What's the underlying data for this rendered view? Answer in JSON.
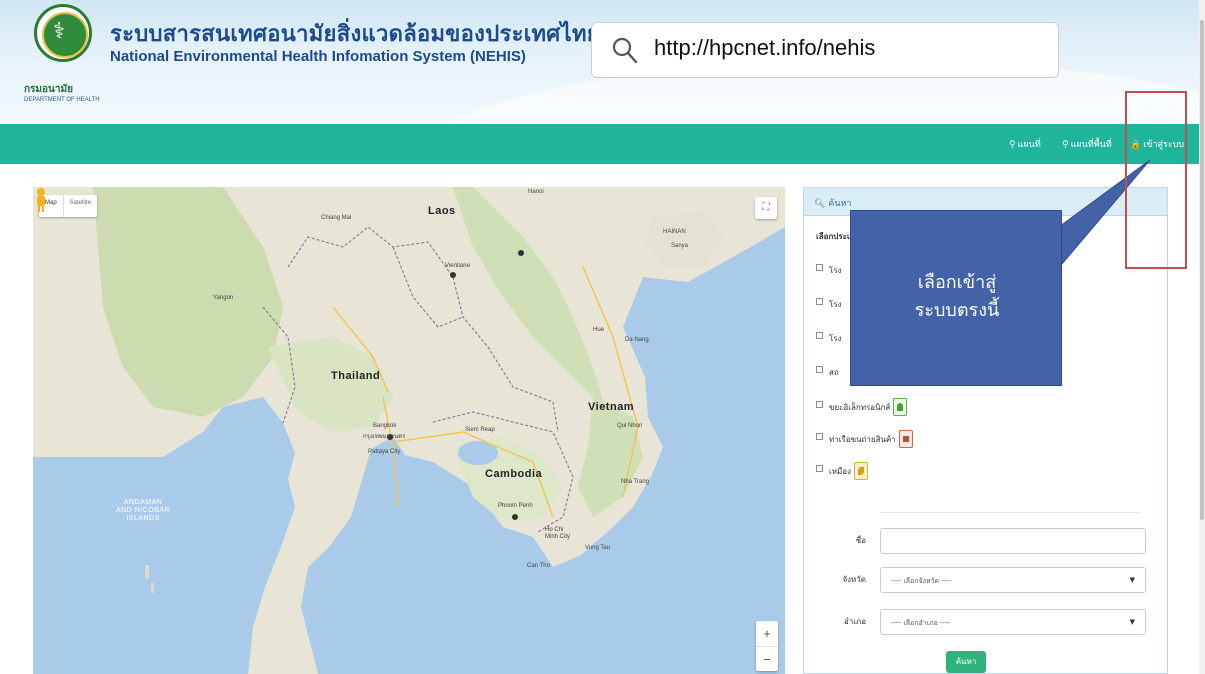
{
  "header": {
    "title_th": "ระบบสารสนเทศอนามัยสิ่งแวดล้อมของประเทศไทย",
    "title_en": "National Environmental Health Infomation System (NEHIS)",
    "logo_caption_th": "กรมอนามัย",
    "logo_caption_en": "DEPARTMENT OF HEALTH",
    "logo_icon": "department-of-health-seal"
  },
  "url_bar": {
    "search_icon": "search-icon",
    "url": "http://hpcnet.info/nehis"
  },
  "navbar": {
    "color": "#1fb59a",
    "items": [
      {
        "icon": "map-pin-icon",
        "label": "แผนที่"
      },
      {
        "icon": "map-pin-icon",
        "label": "แผนที่พื้นที่"
      },
      {
        "icon": "lock-icon",
        "label": "เข้าสู่ระบบ"
      }
    ]
  },
  "map": {
    "map_type": [
      "Map",
      "Satellite"
    ],
    "zoom": [
      "+",
      "−"
    ],
    "labels": {
      "laos": "Laos",
      "thailand": "Thailand",
      "cambodia": "Cambodia",
      "vietnam": "Vietnam",
      "hainan": "HAINAN",
      "andaman": "ANDAMAN\nAND NICOBAR\nISLANDS",
      "bangkok": "Bangkok",
      "bangkok_th": "กรุงเทพมหานคร",
      "phnom_penh": "Phnom Penh",
      "ho_chi_minh": "Ho Chi\nMinh City",
      "vientiane": "Vientiane",
      "hanoi": "Hanoi",
      "chiang_mai": "Chiang Mai",
      "yangon": "Yangon",
      "da_nang": "Da Nang",
      "qui_nhon": "Qui Nhon",
      "nha_trang": "Nha Trang",
      "hue": "Hue",
      "pattaya": "Pattaya City",
      "siem_reap": "Siem Reap",
      "can_tho": "Can Tho",
      "vung_tau": "Vung Tau",
      "sanya": "Sanya"
    }
  },
  "panel": {
    "header": "ค้นหา",
    "select_label": "เลือกประเภท",
    "checkboxes": [
      {
        "label": "โรง",
        "marker": ""
      },
      {
        "label": "โรง",
        "marker": ""
      },
      {
        "label": "โรง",
        "marker": ""
      },
      {
        "label": "สถ",
        "marker": ""
      },
      {
        "label": "ขยะอิเล็กทรอนิกส์",
        "marker": "green"
      },
      {
        "label": "ท่าเรือขนถ่ายสินค้า",
        "marker": "brown"
      },
      {
        "label": "เหมือง",
        "marker": "yellow"
      }
    ],
    "name_label": "ชื่อ",
    "name_value": "",
    "province_label": "จังหวัด",
    "province_value": "---- เลือกจังหวัด ----",
    "district_label": "อำเภอ",
    "district_value": "---- เลือกอำเภอ ----",
    "search_button": "ค้นหา"
  },
  "annotation": {
    "line1": "เลือกเข้าสู่",
    "line2": "ระบบตรงนี้",
    "box_color": "#4462a7",
    "highlight_color": "#c0504d"
  }
}
